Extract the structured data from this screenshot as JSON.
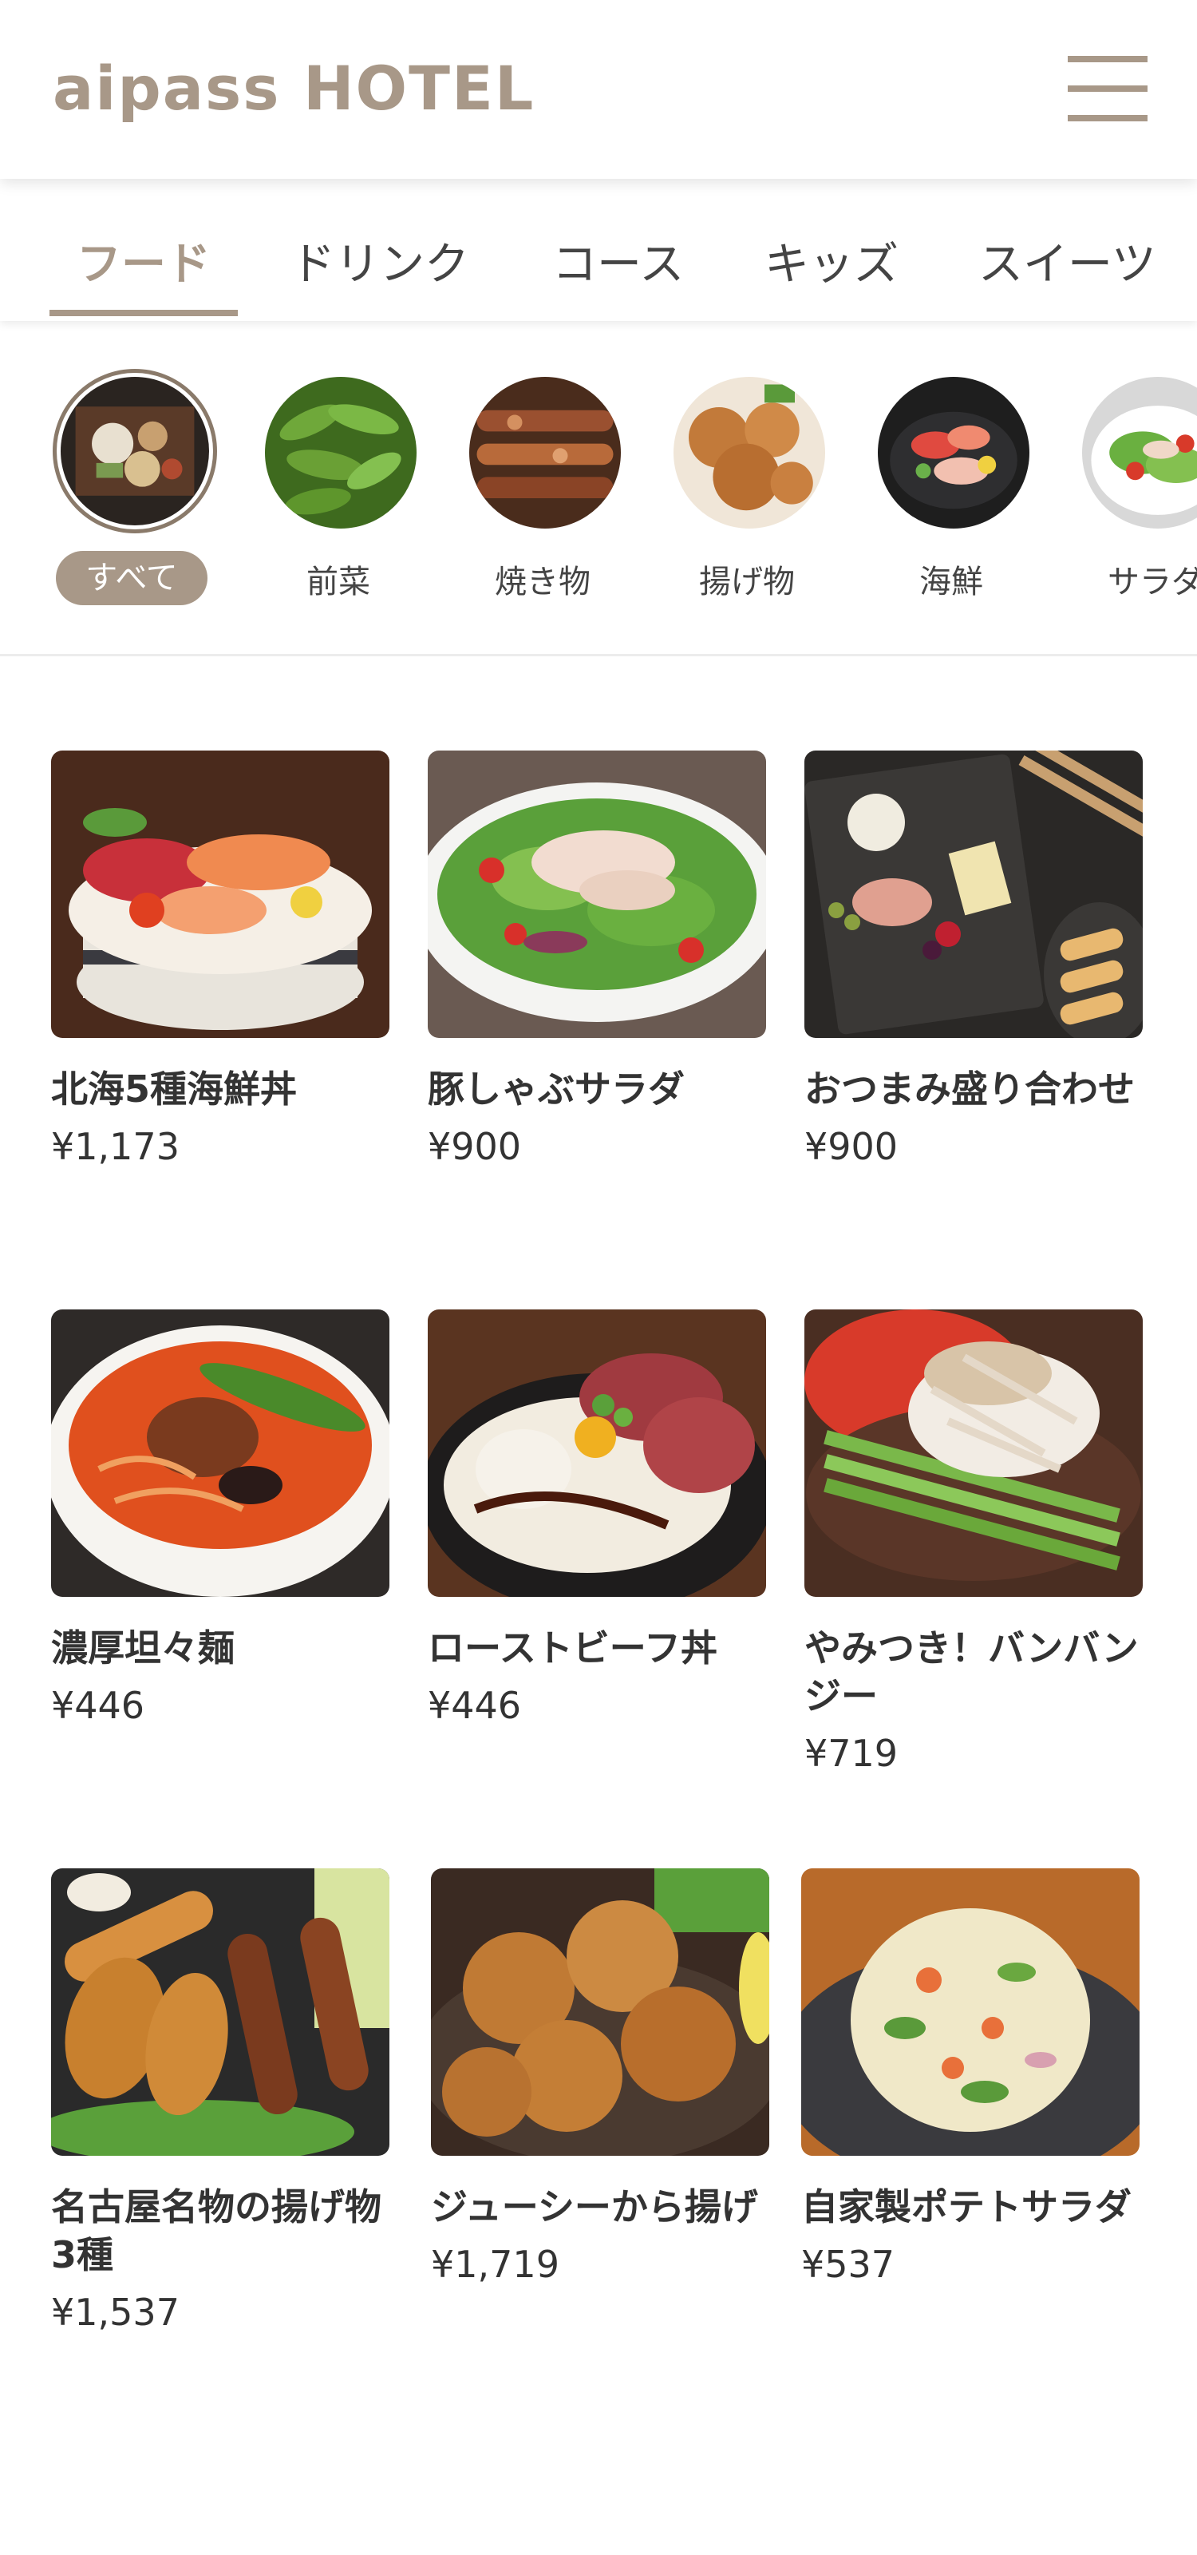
{
  "header": {
    "logo": "aipass HOTEL",
    "menu_icon": "hamburger-menu-icon",
    "brand_color": "#a89888"
  },
  "tabs": [
    {
      "label": "フード",
      "active": true
    },
    {
      "label": "ドリンク",
      "active": false
    },
    {
      "label": "コース",
      "active": false
    },
    {
      "label": "キッズ",
      "active": false
    },
    {
      "label": "スイーツ",
      "active": false
    }
  ],
  "categories": [
    {
      "label": "すべて",
      "active": true,
      "icon": "set-meal-photo"
    },
    {
      "label": "前菜",
      "active": false,
      "icon": "edamame-photo"
    },
    {
      "label": "焼き物",
      "active": false,
      "icon": "yakitori-photo"
    },
    {
      "label": "揚げ物",
      "active": false,
      "icon": "karaage-photo"
    },
    {
      "label": "海鮮",
      "active": false,
      "icon": "sashimi-photo"
    },
    {
      "label": "サラダ",
      "active": false,
      "icon": "salad-photo"
    }
  ],
  "items": [
    {
      "name": "北海5種海鮮丼",
      "price": "¥1,173",
      "photo": "seafood-bowl-photo"
    },
    {
      "name": "豚しゃぶサラダ",
      "price": "¥900",
      "photo": "pork-shabu-salad-photo"
    },
    {
      "name": "おつまみ盛り合わせ",
      "price": "¥900",
      "photo": "appetizer-platter-photo"
    },
    {
      "name": "濃厚坦々麺",
      "price": "¥446",
      "photo": "tantanmen-photo"
    },
    {
      "name": "ローストビーフ丼",
      "price": "¥446",
      "photo": "roast-beef-bowl-photo"
    },
    {
      "name": "やみつき！バンバンジー",
      "price": "¥719",
      "photo": "bang-bang-chicken-photo"
    },
    {
      "name": "名古屋名物の揚げ物3種",
      "price": "¥1,537",
      "photo": "fried-assortment-photo"
    },
    {
      "name": "ジューシーから揚げ",
      "price": "¥1,719",
      "photo": "karaage-photo"
    },
    {
      "name": "自家製ポテトサラダ",
      "price": "¥537",
      "photo": "potato-salad-photo"
    }
  ]
}
